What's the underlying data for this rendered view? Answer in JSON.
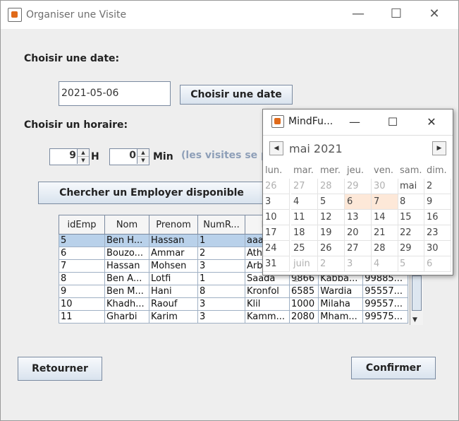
{
  "window": {
    "title": "Organiser une Visite",
    "min_glyph": "—",
    "max_glyph": "☐",
    "close_glyph": "✕"
  },
  "form": {
    "date_label": "Choisir une date:",
    "date_value": "2021-05-06",
    "date_button": "Choisir une date",
    "time_label": "Choisir un horaire:",
    "hour_value": "9",
    "hour_unit": "H",
    "min_value": "0",
    "min_unit": "Min",
    "note": "(les visites se pa",
    "search_button": "Chercher un Employer disponible",
    "back_button": "Retourner",
    "confirm_button": "Confirmer"
  },
  "table": {
    "columns": [
      "idEmp",
      "Nom",
      "Prenom",
      "NumR...",
      "Ru"
    ],
    "rows": [
      [
        "5",
        "Ben H...",
        "Hassan",
        "1",
        "aaaaa",
        "",
        "",
        ""
      ],
      [
        "6",
        "Bouzo...",
        "Ammar",
        "2",
        "Athen",
        "",
        "",
        ""
      ],
      [
        "7",
        "Hassan",
        "Mohsen",
        "3",
        "Arbi",
        "",
        "",
        ""
      ],
      [
        "8",
        "Ben A...",
        "Lotfi",
        "1",
        "Saada",
        "9866",
        "Kabba...",
        "99885..."
      ],
      [
        "9",
        "Ben M...",
        "Hani",
        "8",
        "Kronfol",
        "6585",
        "Wardia",
        "95557..."
      ],
      [
        "10",
        "Khadh...",
        "Raouf",
        "3",
        "Klil",
        "1000",
        "Milaha",
        "99557..."
      ],
      [
        "11",
        "Gharbi",
        "Karim",
        "3",
        "Kamm...",
        "2080",
        "Mham...",
        "99575..."
      ]
    ],
    "selected_row": 0
  },
  "calendar": {
    "title": "MindFu...",
    "month": "mai 2021",
    "prev_glyph": "◀",
    "next_glyph": "▶",
    "weekdays": [
      "lun.",
      "mar.",
      "mer.",
      "jeu.",
      "ven.",
      "sam.",
      "dim."
    ],
    "weeks": [
      [
        "26",
        "27",
        "28",
        "29",
        "30",
        "mai",
        "2"
      ],
      [
        "3",
        "4",
        "5",
        "6",
        "7",
        "8",
        "9"
      ],
      [
        "10",
        "11",
        "12",
        "13",
        "14",
        "15",
        "16"
      ],
      [
        "17",
        "18",
        "19",
        "20",
        "21",
        "22",
        "23"
      ],
      [
        "24",
        "25",
        "26",
        "27",
        "28",
        "29",
        "30"
      ],
      [
        "31",
        "juin 1",
        "2",
        "3",
        "4",
        "5",
        "6"
      ]
    ],
    "highlighted_days": [
      "6",
      "7"
    ]
  }
}
